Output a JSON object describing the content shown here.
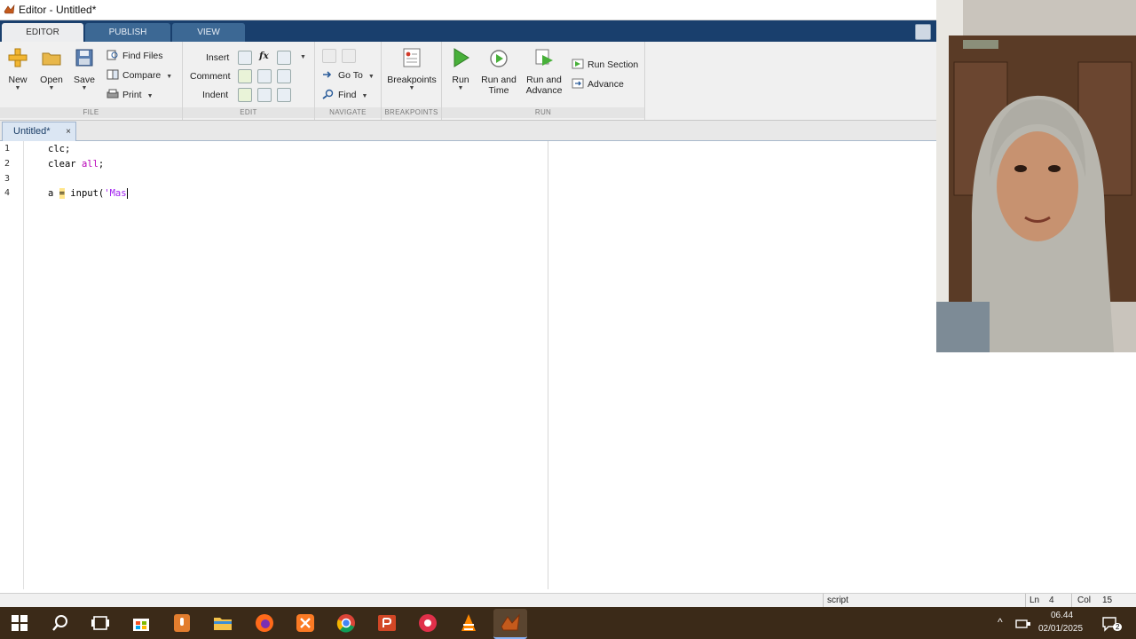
{
  "window": {
    "title": "Editor - Untitled*"
  },
  "ribbon_tabs": [
    {
      "label": "EDITOR",
      "active": true
    },
    {
      "label": "PUBLISH",
      "active": false
    },
    {
      "label": "VIEW",
      "active": false
    }
  ],
  "ribbon": {
    "file": {
      "label": "FILE",
      "new": "New",
      "open": "Open",
      "save": "Save",
      "find_files": "Find Files",
      "compare": "Compare",
      "print": "Print"
    },
    "edit": {
      "label": "EDIT",
      "insert": "Insert",
      "comment": "Comment",
      "indent": "Indent",
      "fx": "fx"
    },
    "navigate": {
      "label": "NAVIGATE",
      "go_to": "Go To",
      "find": "Find"
    },
    "breakpoints": {
      "label": "BREAKPOINTS",
      "breakpoints": "Breakpoints"
    },
    "run": {
      "label": "RUN",
      "run": "Run",
      "run_and_time_1": "Run and",
      "run_and_time_2": "Time",
      "run_and_advance_1": "Run and",
      "run_and_advance_2": "Advance",
      "run_section": "Run Section",
      "advance": "Advance"
    }
  },
  "document_tab": {
    "label": "Untitled*",
    "close": "×"
  },
  "editor": {
    "line_numbers": [
      "1",
      "2",
      "3",
      "4"
    ],
    "line1": "clc;",
    "line2_a": "clear ",
    "line2_kw": "all",
    "line2_b": ";",
    "line4_a": "a ",
    "line4_eq": "=",
    "line4_b": " input(",
    "line4_str": "'Mas"
  },
  "status_bar": {
    "mode": "script",
    "ln_label": "Ln",
    "ln": "4",
    "col_label": "Col",
    "col": "15"
  },
  "taskbar": {
    "time": "06.44",
    "date": "02/01/2025",
    "notifications": "2"
  },
  "colors": {
    "ribbon_tab_bg": "#193f6d",
    "ribbon_bg": "#f0f0f0",
    "taskbar_bg": "#3b2a18",
    "keyword": "#b800b8",
    "string": "#a020f0"
  }
}
